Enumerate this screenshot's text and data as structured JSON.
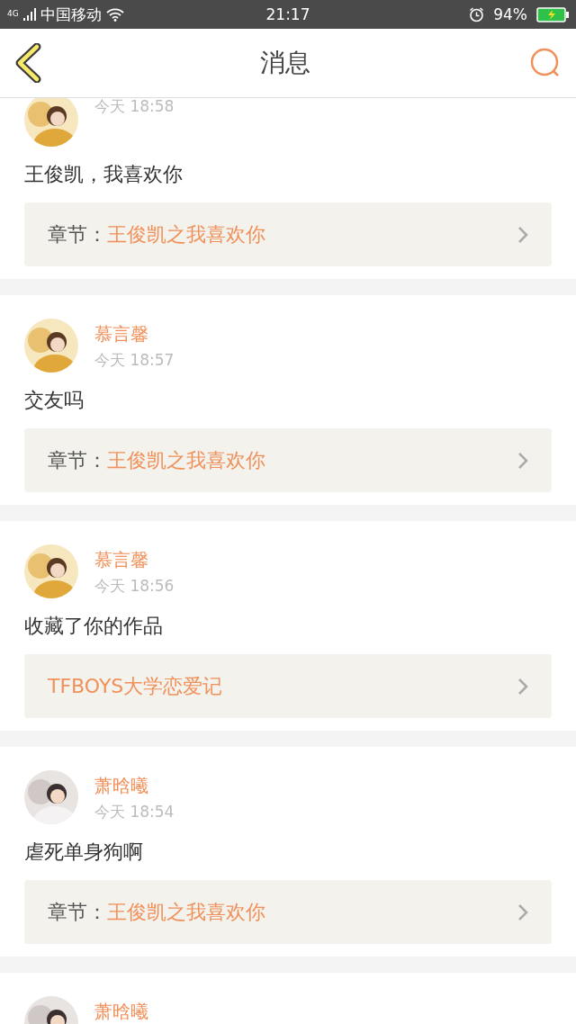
{
  "status_bar": {
    "network": "4G",
    "carrier": "中国移动",
    "time": "21:17",
    "battery": "94%"
  },
  "nav": {
    "title": "消息"
  },
  "messages": [
    {
      "time": "今天 18:58",
      "text": "王俊凯，我喜欢你",
      "link": {
        "kind": "chapter",
        "label": "章节：",
        "title": "王俊凯之我喜欢你"
      }
    },
    {
      "name": "慕言馨",
      "time": "今天 18:57",
      "text": "交友吗",
      "link": {
        "kind": "chapter",
        "label": "章节：",
        "title": "王俊凯之我喜欢你"
      }
    },
    {
      "name": "慕言馨",
      "time": "今天 18:56",
      "text": "收藏了你的作品",
      "link": {
        "kind": "work",
        "title": "TFBOYS大学恋爱记"
      }
    },
    {
      "name": "萧晗曦",
      "time": "今天 18:54",
      "text": "虐死单身狗啊",
      "link": {
        "kind": "chapter",
        "label": "章节：",
        "title": "王俊凯之我喜欢你"
      }
    },
    {
      "name": "萧晗曦"
    }
  ]
}
